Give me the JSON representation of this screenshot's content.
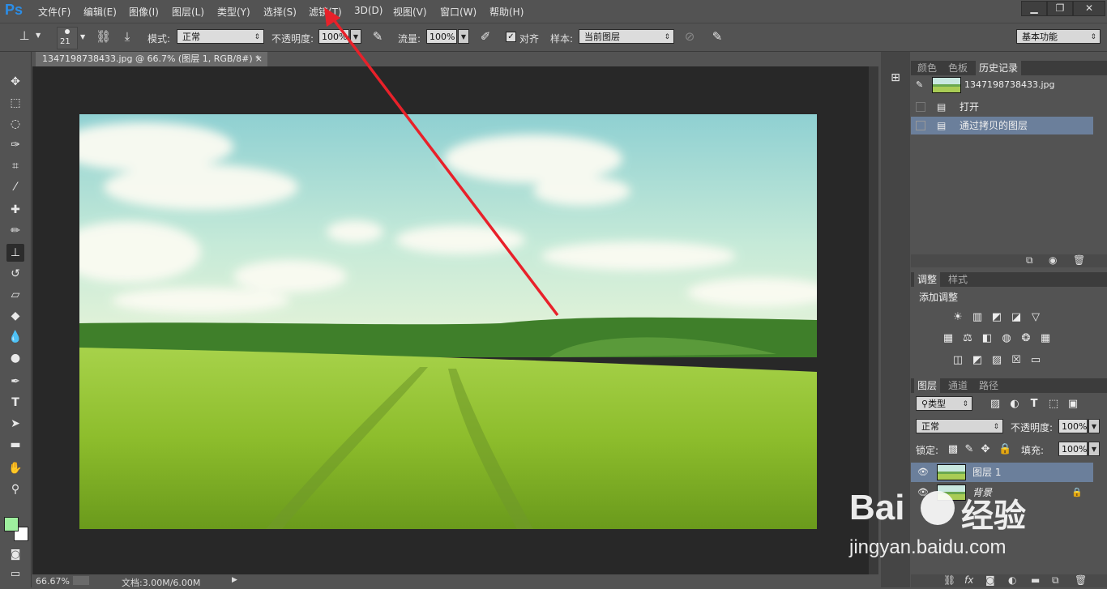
{
  "app": {
    "logo": "Ps"
  },
  "menu": [
    "文件(F)",
    "编辑(E)",
    "图像(I)",
    "图层(L)",
    "类型(Y)",
    "选择(S)",
    "滤镜(T)",
    "3D(D)",
    "视图(V)",
    "窗口(W)",
    "帮助(H)"
  ],
  "window_controls": {
    "minimize": "▁",
    "restore": "❐",
    "close": "✕"
  },
  "options": {
    "brush_size": "21",
    "mode_label": "模式:",
    "mode_value": "正常",
    "opacity_label": "不透明度:",
    "opacity_value": "100%",
    "flow_label": "流量:",
    "flow_value": "100%",
    "align_label": "对齐",
    "sample_label": "样本:",
    "sample_value": "当前图层",
    "workspace": "基本功能"
  },
  "document": {
    "tab_title": "1347198738433.jpg @ 66.7% (图层 1, RGB/8#) *",
    "tab_close": "×",
    "zoom": "66.67%",
    "doc_info": "文档:3.00M/6.00M"
  },
  "history_panel": {
    "tabs": [
      "颜色",
      "色板",
      "历史记录"
    ],
    "snapshot_name": "1347198738433.jpg",
    "entries": [
      "打开",
      "通过拷贝的图层"
    ]
  },
  "adjustments_panel": {
    "tabs": [
      "调整",
      "样式"
    ],
    "title": "添加调整"
  },
  "layers_panel": {
    "tabs": [
      "图层",
      "通道",
      "路径"
    ],
    "filter": "类型",
    "blend_mode": "正常",
    "opacity_label": "不透明度:",
    "opacity_value": "100%",
    "lock_label": "锁定:",
    "fill_label": "填充:",
    "fill_value": "100%",
    "layers": [
      {
        "name": "图层 1"
      },
      {
        "name": "背景"
      }
    ]
  },
  "watermark": {
    "brand": "Bai",
    "brand2": "经验",
    "url": "jingyan.baidu.com"
  },
  "colors": {
    "foreground": "#9ff09f",
    "background": "#ffffff",
    "arrow": "#e8212a",
    "selection": "#6b7f9b"
  }
}
